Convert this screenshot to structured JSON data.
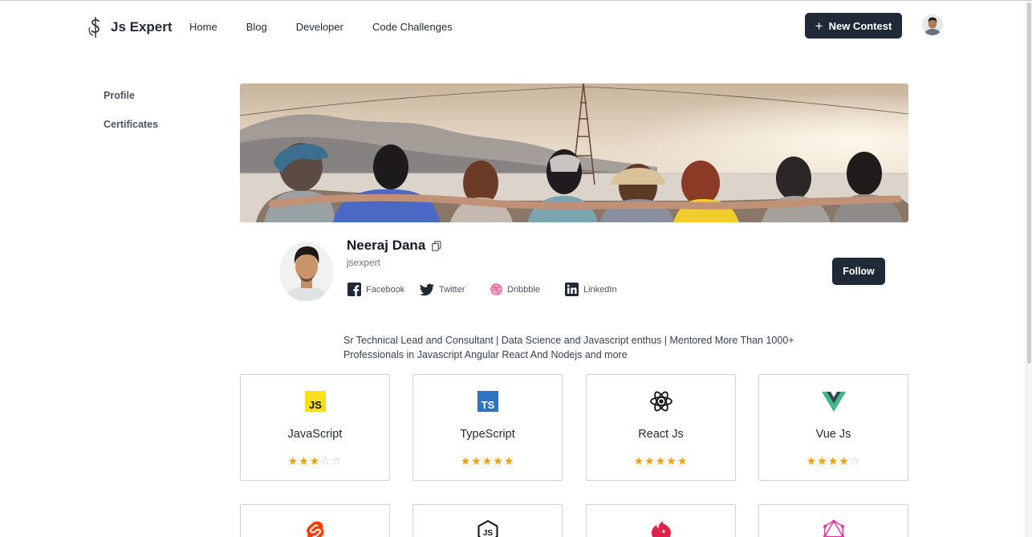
{
  "header": {
    "logo_text": "Js Expert",
    "nav": [
      "Home",
      "Blog",
      "Developer",
      "Code Challenges"
    ],
    "new_contest_label": "New Contest"
  },
  "sidebar": {
    "items": [
      {
        "label": "Profile"
      },
      {
        "label": "Certificates"
      }
    ]
  },
  "profile": {
    "name": "Neeraj Dana",
    "username": "jsexpert",
    "follow_label": "Follow",
    "socials": [
      {
        "label": "Facebook",
        "icon": "facebook-icon"
      },
      {
        "label": "Twitter",
        "icon": "twitter-icon"
      },
      {
        "label": "Dribbble",
        "icon": "dribbble-icon"
      },
      {
        "label": "LinkedIn",
        "icon": "linkedin-icon"
      }
    ],
    "bio": "Sr Technical Lead and Consultant | Data Science and Javascript enthus | Mentored More Than 1000+ Professionals in Javascript Angular React And Nodejs and more"
  },
  "skills": [
    {
      "name": "JavaScript",
      "rating": 3,
      "max": 5,
      "icon": "javascript-icon"
    },
    {
      "name": "TypeScript",
      "rating": 5,
      "max": 5,
      "icon": "typescript-icon"
    },
    {
      "name": "React Js",
      "rating": 5,
      "max": 5,
      "icon": "react-icon"
    },
    {
      "name": "Vue Js",
      "rating": 4,
      "max": 5,
      "icon": "vue-icon"
    },
    {
      "name": "",
      "rating": 0,
      "max": 5,
      "icon": "svelte-icon"
    },
    {
      "name": "",
      "rating": 0,
      "max": 5,
      "icon": "nodejs-icon"
    },
    {
      "name": "",
      "rating": 0,
      "max": 5,
      "icon": "nestjs-icon"
    },
    {
      "name": "",
      "rating": 0,
      "max": 5,
      "icon": "graphql-icon"
    }
  ],
  "colors": {
    "primary": "#1f2937",
    "star": "#f59e0b",
    "star_empty": "#c4c7cc",
    "border": "#d1d5db"
  }
}
